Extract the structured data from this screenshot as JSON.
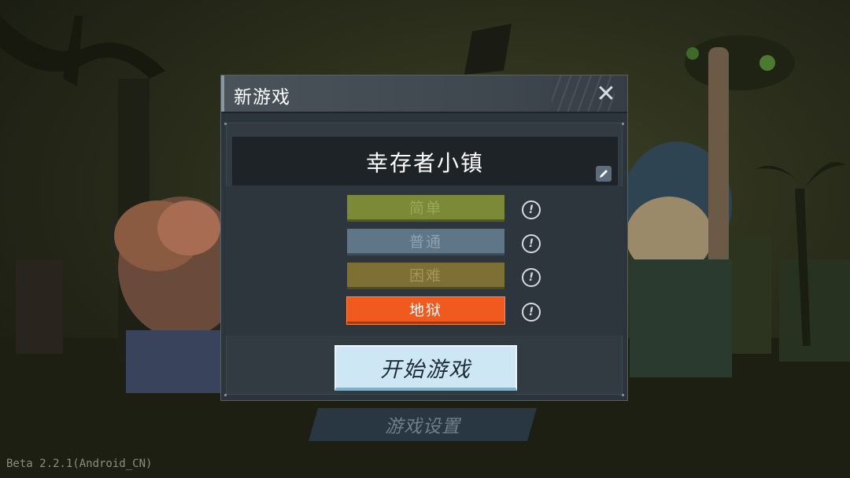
{
  "dialog": {
    "title": "新游戏",
    "close_glyph": "✕",
    "town_name": "幸存者小镇",
    "edit_icon": "pencil-icon",
    "difficulties": [
      {
        "label": "简单",
        "bg": "#7c8a37",
        "text": "#9aa85a",
        "selected": false
      },
      {
        "label": "普通",
        "bg": "#5e7688",
        "text": "#8ea1b0",
        "selected": false
      },
      {
        "label": "困难",
        "bg": "#7e7034",
        "text": "#a3955a",
        "selected": false
      },
      {
        "label": "地狱",
        "bg": "#f05a1e",
        "text": "#ffffff",
        "selected": true
      }
    ],
    "info_glyph": "!",
    "start_label": "开始游戏"
  },
  "settings_label": "游戏设置",
  "version": "Beta 2.2.1(Android_CN)",
  "colors": {
    "dialog_bg": "#2c343c",
    "start_bg": "#cde8f4",
    "hell_accent": "#f05a1e"
  }
}
